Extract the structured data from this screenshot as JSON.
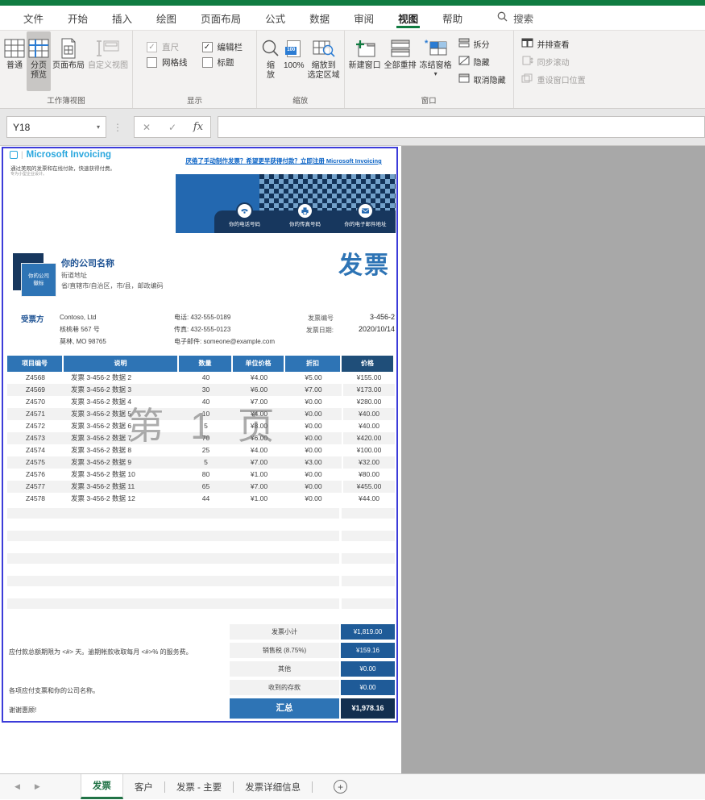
{
  "ribbon_tabs": {
    "items": [
      "文件",
      "开始",
      "插入",
      "绘图",
      "页面布局",
      "公式",
      "数据",
      "审阅",
      "视图",
      "帮助"
    ],
    "active": "视图",
    "search_label": "搜索"
  },
  "ribbon": {
    "workbook_views": {
      "label": "工作簿视图",
      "buttons": [
        {
          "label": "普通",
          "icon": "normal-view-icon"
        },
        {
          "label": "分页\n预览",
          "icon": "page-break-preview-icon",
          "selected": true
        },
        {
          "label": "页面布局",
          "icon": "page-layout-icon"
        },
        {
          "label": "自定义视图",
          "icon": "custom-views-icon",
          "disabled": true
        }
      ]
    },
    "show": {
      "label": "显示",
      "checkboxes": [
        {
          "label": "直尺",
          "checked": true,
          "disabled": true
        },
        {
          "label": "网格线",
          "checked": false
        },
        {
          "label": "编辑栏",
          "checked": true
        },
        {
          "label": "标题",
          "checked": false
        }
      ]
    },
    "zoom": {
      "label": "缩放",
      "badge": "100",
      "buttons": [
        {
          "label": "缩\n放",
          "icon": "zoom-icon"
        },
        {
          "label": "100%",
          "icon": "zoom-100-icon"
        },
        {
          "label": "缩放到\n选定区域",
          "icon": "zoom-selection-icon"
        }
      ]
    },
    "window": {
      "label": "窗口",
      "buttons": [
        {
          "label": "新建窗口",
          "icon": "new-window-icon"
        },
        {
          "label": "全部重排",
          "icon": "arrange-all-icon"
        },
        {
          "label": "冻结窗格",
          "icon": "freeze-panes-icon",
          "dropdown": true
        }
      ],
      "small_buttons": [
        {
          "label": "拆分",
          "icon": "split-icon"
        },
        {
          "label": "隐藏",
          "icon": "hide-icon"
        },
        {
          "label": "取消隐藏",
          "icon": "unhide-icon"
        }
      ]
    },
    "compare": {
      "small_buttons": [
        {
          "label": "并排查看",
          "icon": "view-side-by-side-icon"
        },
        {
          "label": "同步滚动",
          "icon": "sync-scroll-icon",
          "disabled": true
        },
        {
          "label": "重设窗口位置",
          "icon": "reset-window-icon",
          "disabled": true
        }
      ]
    }
  },
  "formula_bar": {
    "name_box": "Y18",
    "fx": "fx"
  },
  "invoice": {
    "brand": {
      "logo_text": "Microsoft Invoicing",
      "tagline": "通过美观的发票和在线付款，快速获得付费。",
      "tagline2": "专为小型企业设计。"
    },
    "promo_link": "厌倦了手动制作发票？希望更早获得付款？立即注册 Microsoft Invoicing",
    "banner": {
      "contacts": [
        {
          "icon": "phone-icon",
          "label": "你的电话号码"
        },
        {
          "icon": "fax-icon",
          "label": "你的传真号码"
        },
        {
          "icon": "email-icon",
          "label": "你的电子邮件地址"
        }
      ]
    },
    "company": {
      "logo_label": "你的公司\n徽标",
      "name": "你的公司名称",
      "address1": "街道地址",
      "address2": "省/直辖市/自治区，市/县，邮政编码"
    },
    "title": "发票",
    "bill_to": {
      "label": "受票方",
      "lines": [
        "Contoso, Ltd",
        "核桃巷 567 号",
        "莫林, MO 98765"
      ],
      "contact_lines": [
        "电话: 432-555-0189",
        "传真: 432-555-0123",
        "电子邮件: someone@example.com"
      ],
      "number_label": "发票编号",
      "number": "3-456-2",
      "date_label": "发票日期:",
      "date": "2020/10/14"
    },
    "table": {
      "headers": [
        "项目编号",
        "说明",
        "数量",
        "单位价格",
        "折扣",
        "价格"
      ],
      "rows": [
        [
          "Z4568",
          "发票 3-456-2 数据 2",
          "40",
          "¥4.00",
          "¥5.00",
          "¥155.00"
        ],
        [
          "Z4569",
          "发票 3-456-2 数据 3",
          "30",
          "¥6.00",
          "¥7.00",
          "¥173.00"
        ],
        [
          "Z4570",
          "发票 3-456-2 数据 4",
          "40",
          "¥7.00",
          "¥0.00",
          "¥280.00"
        ],
        [
          "Z4571",
          "发票 3-456-2 数据 5",
          "10",
          "¥4.00",
          "¥0.00",
          "¥40.00"
        ],
        [
          "Z4572",
          "发票 3-456-2 数据 6",
          "5",
          "¥8.00",
          "¥0.00",
          "¥40.00"
        ],
        [
          "Z4573",
          "发票 3-456-2 数据 7",
          "70",
          "¥6.00",
          "¥0.00",
          "¥420.00"
        ],
        [
          "Z4574",
          "发票 3-456-2 数据 8",
          "25",
          "¥4.00",
          "¥0.00",
          "¥100.00"
        ],
        [
          "Z4575",
          "发票 3-456-2 数据 9",
          "5",
          "¥7.00",
          "¥3.00",
          "¥32.00"
        ],
        [
          "Z4576",
          "发票 3-456-2 数据 10",
          "80",
          "¥1.00",
          "¥0.00",
          "¥80.00"
        ],
        [
          "Z4577",
          "发票 3-456-2 数据 11",
          "65",
          "¥7.00",
          "¥0.00",
          "¥455.00"
        ],
        [
          "Z4578",
          "发票 3-456-2 数据 12",
          "44",
          "¥1.00",
          "¥0.00",
          "¥44.00"
        ]
      ]
    },
    "watermark": "第 1 页",
    "notes": [
      "应付款总额期限为 <#> 天。逾期帐款收取每月 <#>% 的服务费。",
      "各项应付支票和你的公司名称。",
      "谢谢惠顾!"
    ],
    "summary": {
      "rows": [
        {
          "label": "发票小计",
          "value": "¥1,819.00"
        },
        {
          "label": "销售税 (8.75%)",
          "value": "¥159.16"
        },
        {
          "label": "其他",
          "value": "¥0.00"
        },
        {
          "label": "收到的存款",
          "value": "¥0.00"
        }
      ],
      "total": {
        "label": "汇总",
        "value": "¥1,978.16"
      }
    }
  },
  "sheet_tabs": {
    "items": [
      {
        "label": "发票",
        "active": true
      },
      {
        "label": "客户"
      },
      {
        "label": "发票 - 主要"
      },
      {
        "label": "发票详细信息"
      }
    ],
    "add_label": "+"
  },
  "colors": {
    "excel_green": "#107C41",
    "header_blue": "#2E74B5",
    "dark_blue": "#1F4E79",
    "navy": "#17375E",
    "page_break_border": "#3c3cd9"
  }
}
